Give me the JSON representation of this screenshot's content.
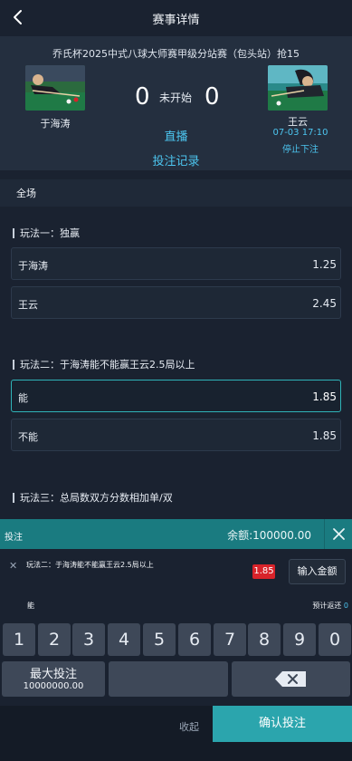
{
  "header": {
    "title": "赛事详情"
  },
  "match": {
    "league": "乔氏杯2025中式八球大师赛甲级分站赛（包头站）抢15",
    "home": {
      "name": "于海涛",
      "score": "0"
    },
    "away": {
      "name": "王云",
      "score": "0",
      "time": "07-03 17:10",
      "note": "停止下注"
    },
    "status": "未开始",
    "live_label": "直播",
    "record_label": "投注记录"
  },
  "section": {
    "label": "全场"
  },
  "plays": [
    {
      "title": "玩法一：独赢",
      "options": [
        {
          "name": "于海涛",
          "odds": "1.25"
        },
        {
          "name": "王云",
          "odds": "2.45"
        }
      ]
    },
    {
      "title": "玩法二：于海涛能不能赢王云2.5局以上",
      "options": [
        {
          "name": "能",
          "odds": "1.85"
        },
        {
          "name": "不能",
          "odds": "1.85"
        }
      ]
    },
    {
      "title": "玩法三：总局数双方分数相加单/双",
      "options": []
    }
  ],
  "betbar": {
    "label": "投注",
    "balance": "余额:100000.00"
  },
  "slip": {
    "description": "玩法二：于海涛能不能赢王云2.5局以上",
    "odds": "1.85",
    "amount_label": "输入金额",
    "selection": "能",
    "return_label": "预计返还",
    "return_value": "0"
  },
  "keypad": {
    "digits": [
      "1",
      "2",
      "3",
      "4",
      "5",
      "6",
      "7",
      "8",
      "9",
      "0"
    ],
    "max_label": "最大投注",
    "max_value": "10000000.00"
  },
  "footer": {
    "collapse_label": "收起",
    "confirm_label": "确认投注"
  },
  "colors": {
    "accent": "#4cc5ef",
    "teal": "#1a7b80",
    "odds_red": "#d8232a",
    "background": "#1a2230"
  }
}
